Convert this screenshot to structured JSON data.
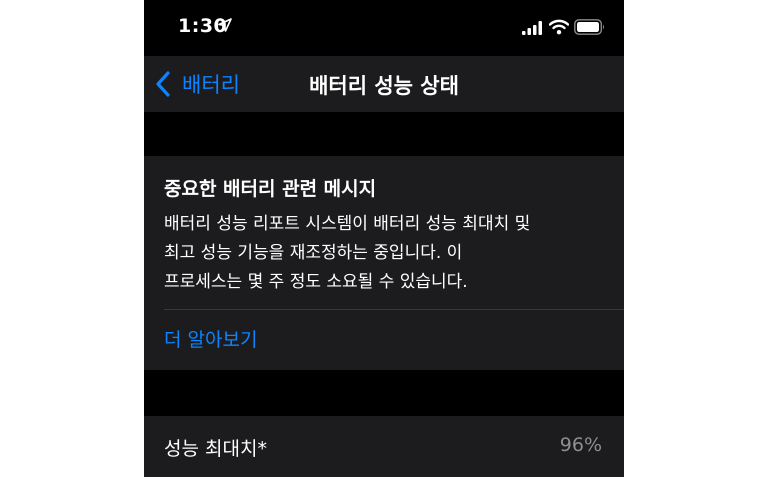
{
  "status_bar": {
    "time": "1:30",
    "icons": [
      "location-arrow-icon",
      "cellular-signal-icon",
      "wifi-icon",
      "battery-icon"
    ]
  },
  "nav": {
    "back_label": "배터리",
    "title": "배터리 성능 상태"
  },
  "message_card": {
    "title": "중요한 배터리 관련 메시지",
    "body_lines": [
      "배터리 성능 리포트 시스템이 배터리 성능 최대치 및",
      "최고 성능 기능을 재조정하는 중입니다. 이",
      "프로세스는 몇 주 정도 소요될 수 있습니다."
    ],
    "link": "더 알아보기"
  },
  "capacity_row": {
    "label": "성능 최대치*",
    "value": "96%"
  },
  "colors": {
    "accent": "#0a84ff",
    "cell_background": "#1c1c1e",
    "background": "#000000",
    "secondary_text": "#8e8e93"
  }
}
